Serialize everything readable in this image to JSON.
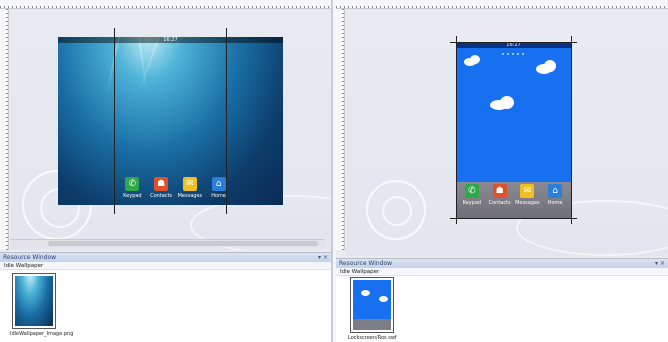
{
  "left_pane": {
    "status_time": "16:27",
    "dock": [
      {
        "label": "Keypad",
        "icon": "phone-icon",
        "color": "#2ea84a",
        "glyph": "✆"
      },
      {
        "label": "Contacts",
        "icon": "contacts-icon",
        "color": "#e0502a",
        "glyph": "☗"
      },
      {
        "label": "Messages",
        "icon": "envelope-icon",
        "color": "#f0c020",
        "glyph": "✉"
      },
      {
        "label": "Home",
        "icon": "home-icon",
        "color": "#2a7fd8",
        "glyph": "⌂"
      }
    ],
    "resource_window_title": "Resource Window",
    "resource_section": "Idle Wallpaper",
    "thumbnail_caption": "IdleWallpaper_Image.png",
    "window_controls": "▾ ×"
  },
  "right_pane": {
    "status_time": "16:27",
    "dock": [
      {
        "label": "Keypad",
        "icon": "phone-icon",
        "color": "#2ea84a",
        "glyph": "✆"
      },
      {
        "label": "Contacts",
        "icon": "contacts-icon",
        "color": "#e0502a",
        "glyph": "☗"
      },
      {
        "label": "Messages",
        "icon": "envelope-icon",
        "color": "#f0c020",
        "glyph": "✉"
      },
      {
        "label": "Home",
        "icon": "home-icon",
        "color": "#2a7fd8",
        "glyph": "⌂"
      }
    ],
    "resource_window_title": "Resource Window",
    "resource_section": "Idle Wallpaper",
    "thumbnail_caption": "Lockscreen/Ros.swf",
    "window_controls": "▾ ×"
  },
  "colors": {
    "sky": "#1670f0",
    "ground": "#7c7d86",
    "ocean_dark": "#0a2a52",
    "panel_header": "#c4d1ea"
  }
}
